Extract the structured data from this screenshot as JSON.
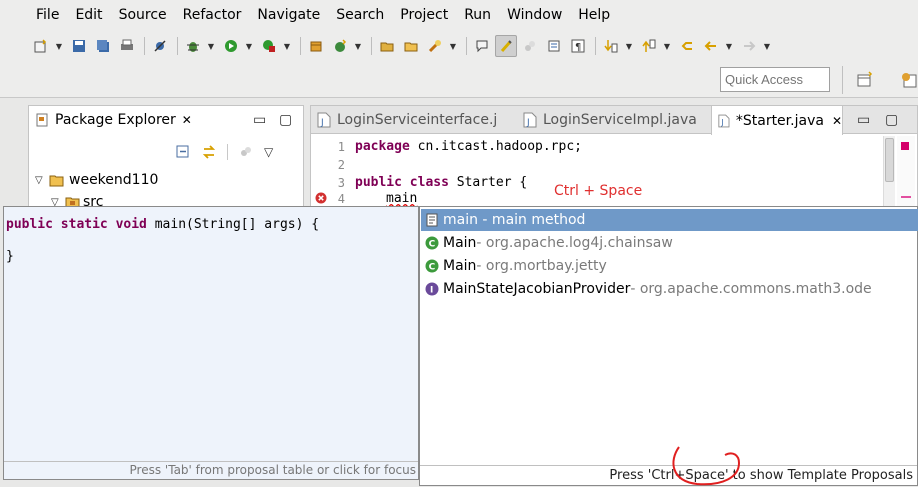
{
  "menu": [
    "File",
    "Edit",
    "Source",
    "Refactor",
    "Navigate",
    "Search",
    "Project",
    "Run",
    "Window",
    "Help"
  ],
  "toolbar": {
    "quick_access_placeholder": "Quick Access"
  },
  "package_explorer": {
    "tab_label": "Package Explorer",
    "close_glyph": "✕",
    "minimize_glyph": "▭",
    "maximize_glyph": "▢",
    "menu_glyph": "▽",
    "tree": [
      {
        "label": "weekend110",
        "icon": "project-folder-icon"
      },
      {
        "label": "src",
        "icon": "source-folder-icon"
      }
    ]
  },
  "editor": {
    "tabs": [
      {
        "label": "LoginServiceinterface.j"
      },
      {
        "label": "LoginServiceImpl.java"
      },
      {
        "label": "*Starter.java"
      }
    ],
    "lines": [
      {
        "num": "1",
        "keyword": "package",
        "rest": " cn.itcast.hadoop.rpc;"
      },
      {
        "num": "2",
        "keyword": "",
        "rest": ""
      },
      {
        "num": "3",
        "keyword": "public class",
        "rest": " Starter {"
      },
      {
        "num": "4",
        "keyword": "",
        "rest": "main"
      }
    ],
    "annotation": "Ctrl + Space",
    "minimize_glyph": "▭",
    "maximize_glyph": "▢"
  },
  "hover": {
    "code": "public static void main(String[] args) {\n\n}",
    "keyword": "public static void",
    "signature": " main(String[] args) {",
    "close_brace": "}",
    "footer": "Press 'Tab' from proposal table or click for focus"
  },
  "proposals": {
    "items": [
      {
        "name": "main - main method",
        "qualifier": "",
        "icon": "template-icon"
      },
      {
        "name": "Main",
        "qualifier": " - org.apache.log4j.chainsaw",
        "icon": "class-icon"
      },
      {
        "name": "Main",
        "qualifier": " - org.mortbay.jetty",
        "icon": "class-icon"
      },
      {
        "name": "MainStateJacobianProvider",
        "qualifier": " - org.apache.commons.math3.ode",
        "icon": "interface-icon"
      }
    ],
    "footer": "Press 'Ctrl+Space' to show Template Proposals"
  },
  "colors": {
    "keyword": "#7f0055",
    "selection": "#6f99c8",
    "annotation": "#e03030"
  }
}
